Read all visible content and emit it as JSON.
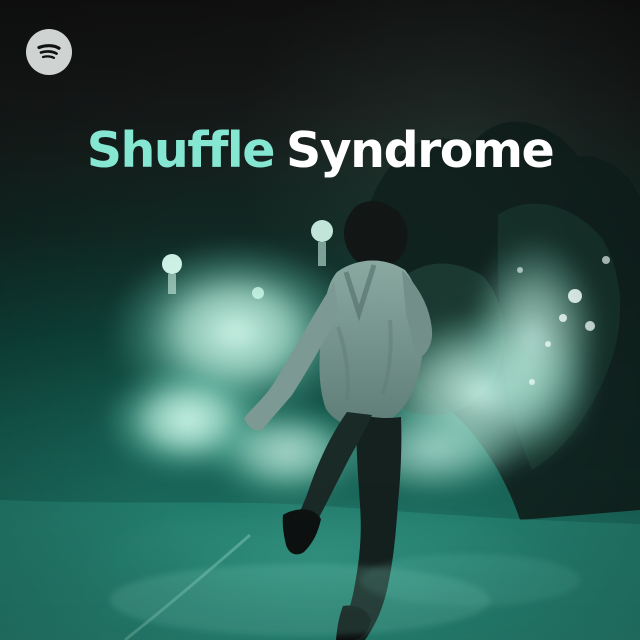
{
  "artwork": {
    "brand_icon": "spotify-logo-icon",
    "title_word_1": "Shuffle",
    "title_word_2": "Syndrome",
    "colors": {
      "accent": "#85e6d2",
      "title_secondary": "#ffffff",
      "logo": "#cfd4d2",
      "teal_dark": "#0d3e35",
      "teal_mid": "#1c6f61",
      "background_dark": "#141414"
    }
  }
}
